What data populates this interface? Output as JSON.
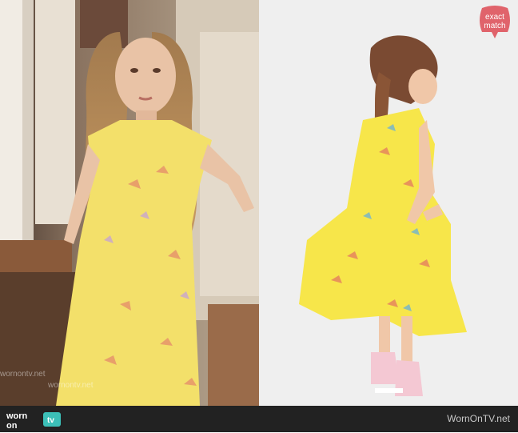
{
  "badge": {
    "line1": "exact",
    "line2": "match",
    "color": "#e0636b"
  },
  "footer": {
    "site": "WornOnTV.net",
    "logo_line1": "worn",
    "logo_line2": "on",
    "logo_line3": "tv",
    "logo_color": "#3cc0b8"
  },
  "watermark": {
    "text": "wornontv.net"
  },
  "colors": {
    "dress": "#f3e06a",
    "dress_right": "#f7e64a",
    "background_right": "#efefef"
  }
}
